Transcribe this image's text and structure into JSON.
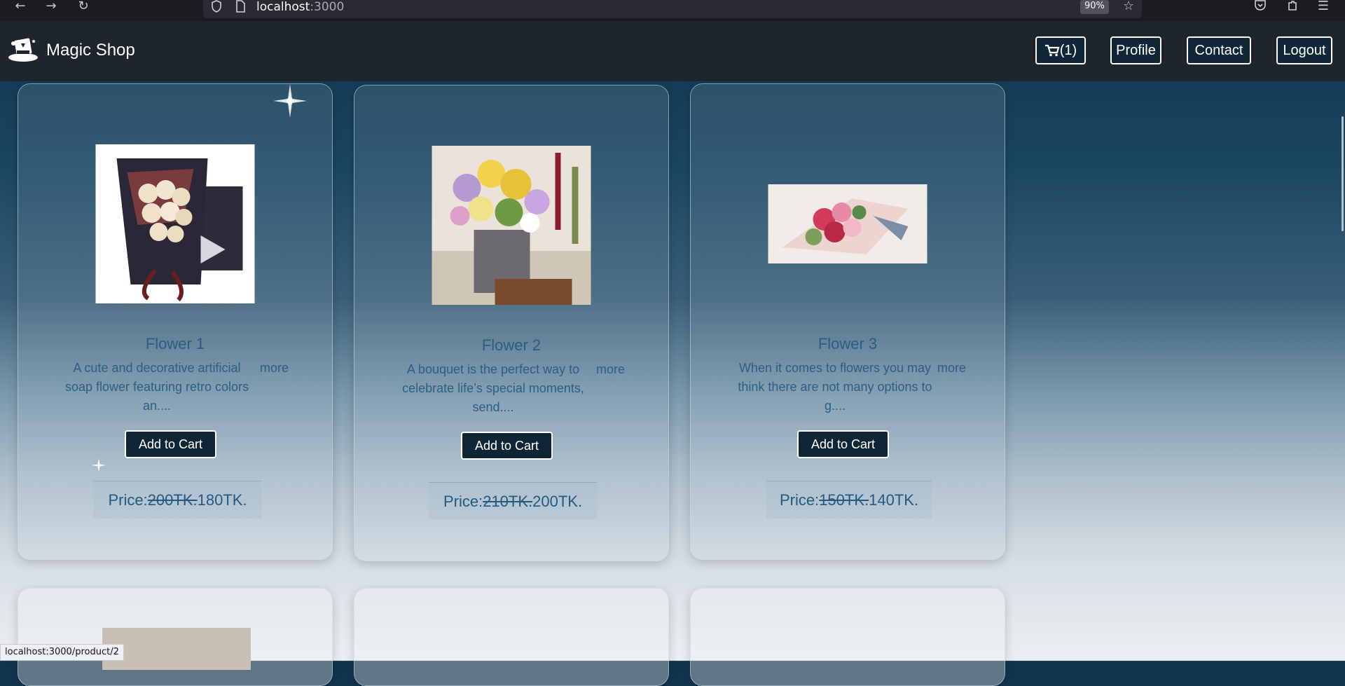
{
  "browser": {
    "url_host": "localhost",
    "url_port": ":3000",
    "zoom": "90%",
    "status_url": "localhost:3000/product/2"
  },
  "navbar": {
    "brand": "Magic Shop",
    "cart_label": "(1)",
    "profile_label": "Profile",
    "contact_label": "Contact",
    "logout_label": "Logout"
  },
  "products": [
    {
      "title": "Flower 1",
      "desc": "A cute and decorative artificial soap flower featuring retro colors an....",
      "more": "more",
      "add_label": "Add to Cart",
      "price_label": "Price:",
      "old_price": "200TK.",
      "new_price": "180TK."
    },
    {
      "title": "Flower 2",
      "desc": "A bouquet is the perfect way to celebrate life’s special moments, send....",
      "more": "more",
      "add_label": "Add to Cart",
      "price_label": "Price:",
      "old_price": "210TK.",
      "new_price": "200TK."
    },
    {
      "title": "Flower 3",
      "desc": "When it comes to flowers you may think there are not many options to g....",
      "more": "more",
      "add_label": "Add to Cart",
      "price_label": "Price:",
      "old_price": "150TK.",
      "new_price": "140TK."
    }
  ],
  "colors": {
    "navbar_bg": "#1f252c",
    "button_bg": "#0f2636",
    "title_color": "#2b5d80"
  }
}
